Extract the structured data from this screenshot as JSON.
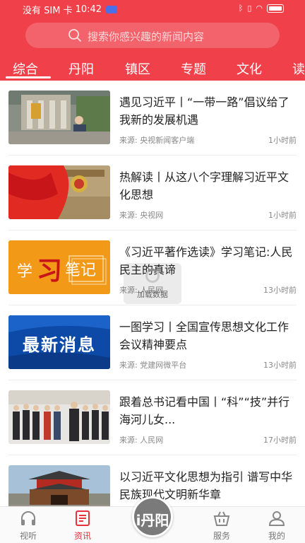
{
  "status_bar": {
    "carrier": "没有 SIM 卡",
    "time": "10:42"
  },
  "search": {
    "placeholder": "搜索你感兴趣的新闻内容"
  },
  "tabs": [
    {
      "label": "综合"
    },
    {
      "label": "丹阳"
    },
    {
      "label": "镇区"
    },
    {
      "label": "专题"
    },
    {
      "label": "文化"
    },
    {
      "label": "读"
    }
  ],
  "news": [
    {
      "title": "遇见习近平丨“一带一路”倡议给了我新的发展机遇",
      "source": "来源:  央视新闻客户端",
      "time": "1小时前"
    },
    {
      "title": "热解读丨从这八个字理解习近平文化思想",
      "source": "来源:  央视网",
      "time": "1小时前"
    },
    {
      "title": "《习近平著作选读》学习笔记:人民民主的真谛",
      "source": "来源:  人民网",
      "time": "13小时前",
      "thumb_text_1": "学",
      "thumb_text_2": "习",
      "thumb_text_3": "笔记"
    },
    {
      "title": "一图学习丨全国宣传思想文化工作会议精神要点",
      "source": "来源:  党建网微平台",
      "time": "13小时前",
      "thumb_text": "最新消息"
    },
    {
      "title": "跟着总书记看中国丨“科”“技”并行  海河儿女...",
      "source": "来源:  人民网",
      "time": "17小时前"
    },
    {
      "title": "以习近平文化思想为指引 谱写中华民族现代文明新华章",
      "source": "",
      "time": ""
    }
  ],
  "loading": {
    "text": "加载数据"
  },
  "bottom_nav": {
    "items": [
      {
        "label": "视听"
      },
      {
        "label": "资讯"
      },
      {
        "label": "服务"
      },
      {
        "label": "我的"
      }
    ],
    "center_label": "i丹阳"
  },
  "colors": {
    "brand": "#f0414b",
    "active_nav": "#e8323c"
  }
}
